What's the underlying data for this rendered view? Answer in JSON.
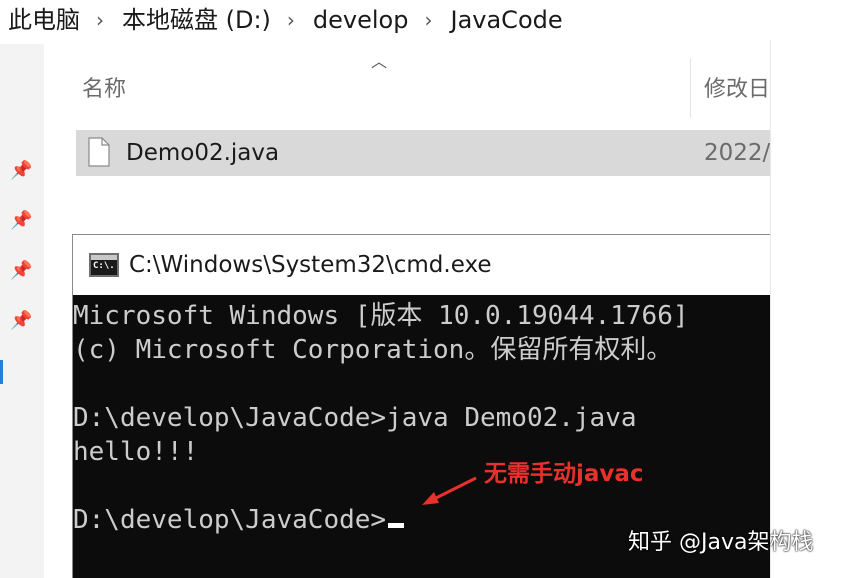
{
  "address_bar": {
    "crumbs": [
      "此电脑",
      "本地磁盘 (D:)",
      "develop",
      "JavaCode"
    ],
    "separator_icon": "chevron-right-icon"
  },
  "explorer": {
    "sort_indicator_icon": "caret-up-icon",
    "columns": {
      "name": "名称",
      "modified": "修改日"
    },
    "file": {
      "name": "Demo02.java",
      "date": "2022/",
      "icon": "document-icon"
    },
    "pinned_icon": "pin-icon"
  },
  "cmd": {
    "title": "C:\\Windows\\System32\\cmd.exe",
    "icon_label": "C:\\.",
    "lines": [
      "Microsoft Windows [版本 10.0.19044.1766]",
      "(c) Microsoft Corporation。保留所有权利。",
      "",
      "D:\\develop\\JavaCode>java Demo02.java",
      "hello!!!",
      "",
      "D:\\develop\\JavaCode>"
    ]
  },
  "annotation": {
    "text": "无需手动javac",
    "color": "#e8312a"
  },
  "watermark": {
    "text": "知乎 @Java架构栈"
  }
}
